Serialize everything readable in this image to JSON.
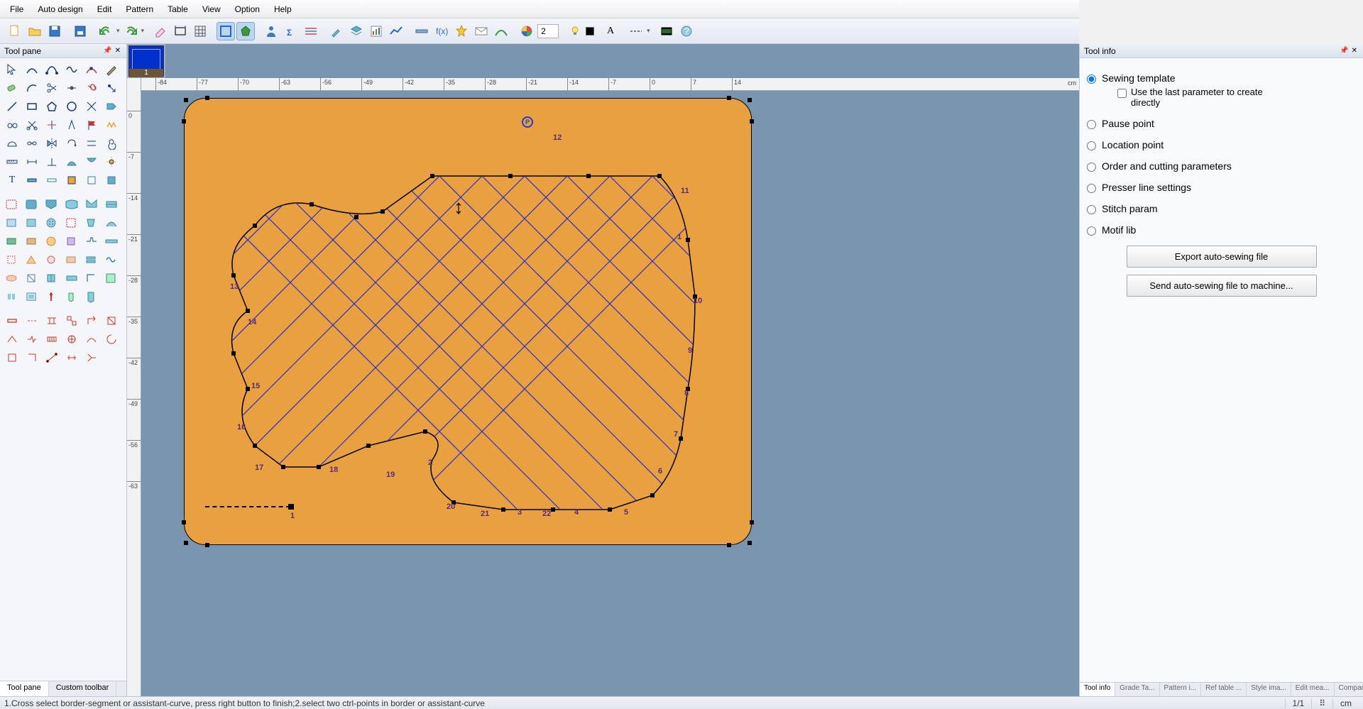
{
  "menu": [
    "File",
    "Auto design",
    "Edit",
    "Pattern",
    "Table",
    "View",
    "Option",
    "Help"
  ],
  "toolbar": {
    "line_weight": "2"
  },
  "left_panel": {
    "title": "Tool pane",
    "tabs": [
      "Tool pane",
      "Custom toolbar"
    ]
  },
  "thumbnail": {
    "label": "1"
  },
  "ruler_h": {
    "ticks": [
      "-84",
      "-77",
      "-70",
      "-63",
      "-56",
      "-49",
      "-42",
      "-35",
      "-28",
      "-21",
      "-14",
      "-7",
      "0",
      "7",
      "14"
    ],
    "unit": "cm"
  },
  "ruler_v": {
    "ticks": [
      "0",
      "-7",
      "-14",
      "-21",
      "-28",
      "-35",
      "-42",
      "-49",
      "-56",
      "-63"
    ]
  },
  "canvas": {
    "p_marker": "P",
    "numbers": [
      "1",
      "2",
      "3",
      "4",
      "5",
      "6",
      "7",
      "8",
      "9",
      "10",
      "11",
      "12",
      "13",
      "14",
      "15",
      "16",
      "17",
      "18",
      "19",
      "20",
      "21",
      "22"
    ],
    "seg_label": "1"
  },
  "right_panel": {
    "title": "Tool info",
    "options": [
      "Sewing template",
      "Pause point",
      "Location point",
      "Order and cutting parameters",
      "Presser line settings",
      "Stitch param",
      "Motif lib"
    ],
    "sub_check": "Use the last parameter to create directly",
    "btn_export": "Export auto-sewing file",
    "btn_send": "Send auto-sewing file to machine...",
    "tabs": [
      "Tool info",
      "Grade Ta...",
      "Pattern i...",
      "Ref table ...",
      "Style ima...",
      "Edit mea...",
      "Compare..."
    ]
  },
  "status": {
    "hint": "1.Cross select border-segment or assistant-curve, press right button to finish;2.select two ctrl-points in border or assistant-curve",
    "page": "1/1",
    "unit": "cm"
  }
}
